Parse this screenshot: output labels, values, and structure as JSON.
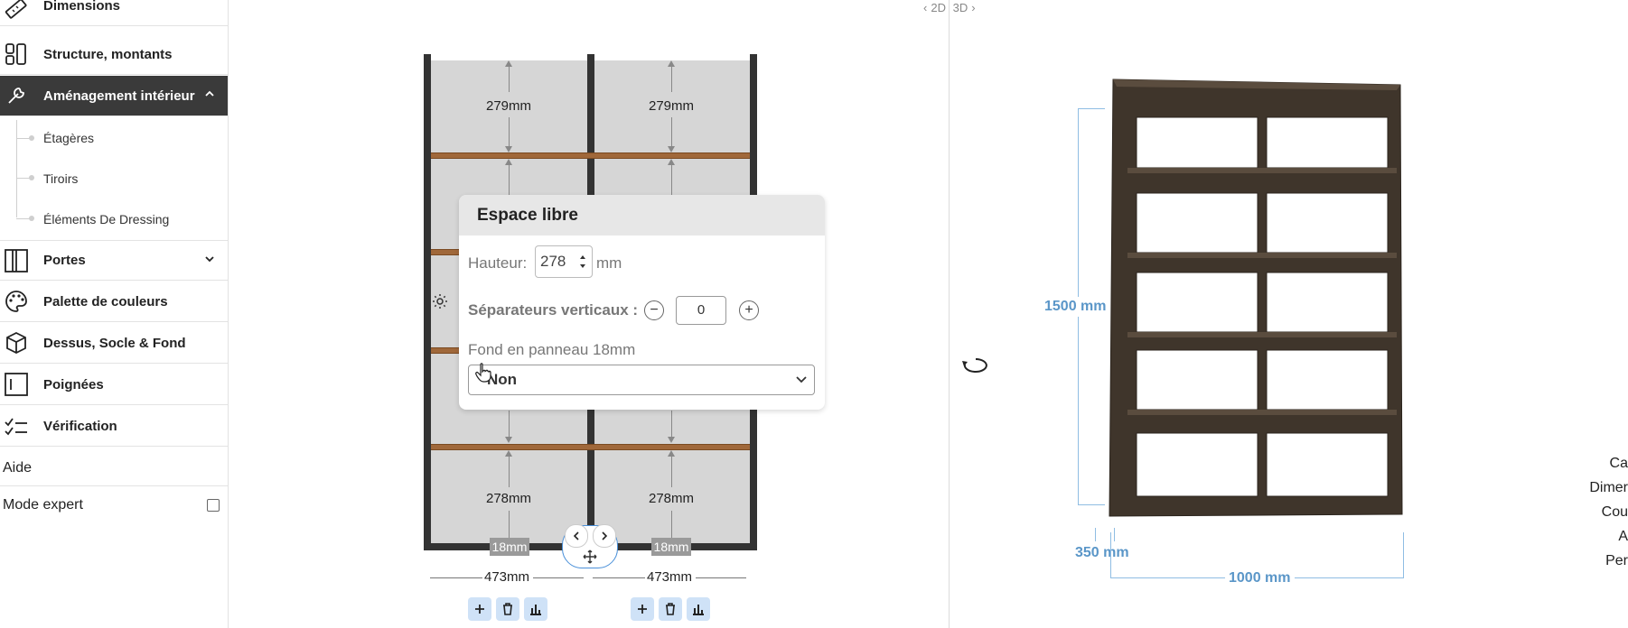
{
  "sidebar": {
    "items": [
      {
        "label": "Dimensions",
        "icon": "ruler-icon"
      },
      {
        "label": "Structure, montants",
        "icon": "structure-icon"
      },
      {
        "label": "Aménagement intérieur",
        "icon": "wrench-icon"
      },
      {
        "label": "Portes",
        "icon": "doors-icon"
      },
      {
        "label": "Palette de couleurs",
        "icon": "palette-icon"
      },
      {
        "label": "Dessus, Socle & Fond",
        "icon": "cube-icon"
      },
      {
        "label": "Poignées",
        "icon": "handle-icon"
      },
      {
        "label": "Vérification",
        "icon": "checklist-icon"
      }
    ],
    "sub_items": [
      "Étagères",
      "Tiroirs",
      "Éléments De Dressing"
    ],
    "help": "Aide",
    "expert_mode": "Mode expert"
  },
  "view_toggle": {
    "left": "2D",
    "right": "3D"
  },
  "view2d": {
    "top_cells": [
      "279mm",
      "279mm"
    ],
    "bottom_cells": [
      "278mm",
      "278mm"
    ],
    "thickness_badges": [
      "18mm",
      "18mm"
    ],
    "column_widths": [
      "473mm",
      "473mm"
    ]
  },
  "popup": {
    "title": "Espace libre",
    "height_label": "Hauteur:",
    "height_value": "278",
    "height_unit": "mm",
    "separators_label": "Séparateurs verticaux :",
    "separators_value": "0",
    "back_label": "Fond en panneau 18mm",
    "back_value": "Non"
  },
  "view3d": {
    "height": "1500 mm",
    "depth": "350 mm",
    "width": "1000 mm",
    "cabinet_color": "#3f352b"
  },
  "cut_off_list": [
    "Ca",
    "Dimer",
    "Cou",
    "A",
    "Per"
  ]
}
